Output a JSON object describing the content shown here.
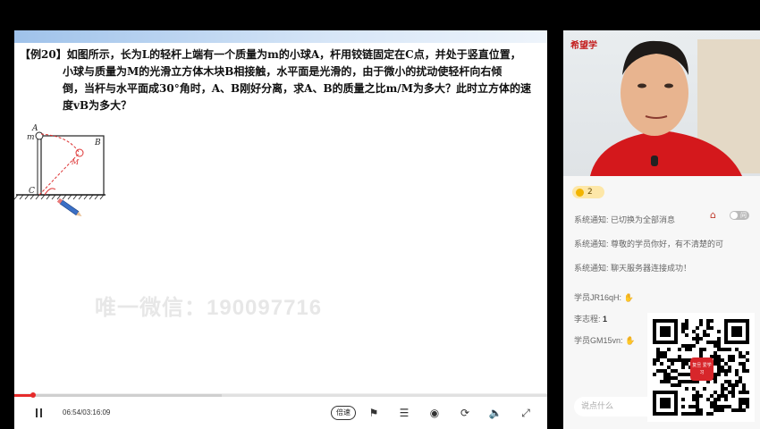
{
  "slide": {
    "problem_tag": "【例20】",
    "problem_line1": "如图所示，长为L的轻杆上端有一个质量为m的小球A，杆用铰链固定在C点，并处于竖直位置，",
    "problem_line2": "小球与质量为M的光滑立方体木块B相接触，水平面是光滑的，由于微小的扰动使轻杆向右倾",
    "problem_line3": "倒，当杆与水平面成30°角时，A、B刚好分离，求A、B的质量之比m/M为多大？此时立方体的速",
    "problem_line4": "度vB为多大？",
    "diagram_labels": {
      "A": "A",
      "m": "m",
      "B": "B",
      "C": "C",
      "M": "M"
    },
    "watermark": "唯一微信：190097716"
  },
  "player": {
    "time": "06:54/03:16:09",
    "speed_label": "倍速",
    "progress_fraction": 0.035,
    "buffered_fraction": 0.39
  },
  "sidebar": {
    "brand": "希望学",
    "viewer_count": "2",
    "messages": [
      {
        "name": "系统通知:",
        "body": "已切换为全部消息"
      },
      {
        "name": "系统通知:",
        "body": "尊敬的学员你好，有不清楚的可"
      },
      {
        "name": "系统通知:",
        "body": "聊天服务器连接成功！"
      },
      {
        "name": "学员JR16qH:",
        "body": ""
      },
      {
        "name": "李志程:",
        "body": "1"
      },
      {
        "name": "学员GM15vn:",
        "body": ""
      }
    ],
    "toggle_label": "问",
    "chat_placeholder": "说点什么",
    "qr_badge": "复旦 爱学习"
  },
  "colors": {
    "accent": "#e62b2b",
    "brand": "#c41e1e"
  }
}
